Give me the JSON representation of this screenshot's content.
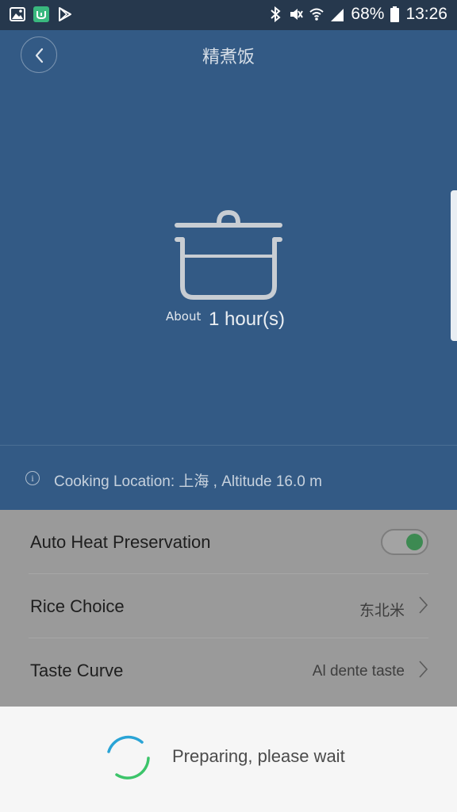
{
  "status_bar": {
    "battery": "68%",
    "time": "13:26",
    "icons": [
      "gallery-icon",
      "mi-home-icon",
      "play-store-icon",
      "bluetooth-icon",
      "mute-icon",
      "wifi-icon",
      "signal-icon",
      "battery-icon"
    ]
  },
  "header": {
    "title": "精煮饭",
    "back_icon": "chevron-left-icon"
  },
  "hero": {
    "about_label": "About",
    "duration": "1 hour(s)",
    "icon": "pot-icon"
  },
  "location": {
    "icon": "info-icon",
    "text": "Cooking Location: 上海 , Altitude 16.0 m"
  },
  "settings": {
    "auto_heat": {
      "label": "Auto Heat Preservation",
      "enabled": true
    },
    "rice_choice": {
      "label": "Rice Choice",
      "value": "东北米"
    },
    "taste_curve": {
      "label": "Taste Curve",
      "value": "Al dente taste"
    }
  },
  "sheet": {
    "message": "Preparing, please wait"
  },
  "colors": {
    "hero_bg": "#335a85",
    "status_bg": "#26384d",
    "toggle_on": "#3d8a52",
    "spinner_blue": "#2aa4d6",
    "spinner_green": "#3cc46a"
  }
}
